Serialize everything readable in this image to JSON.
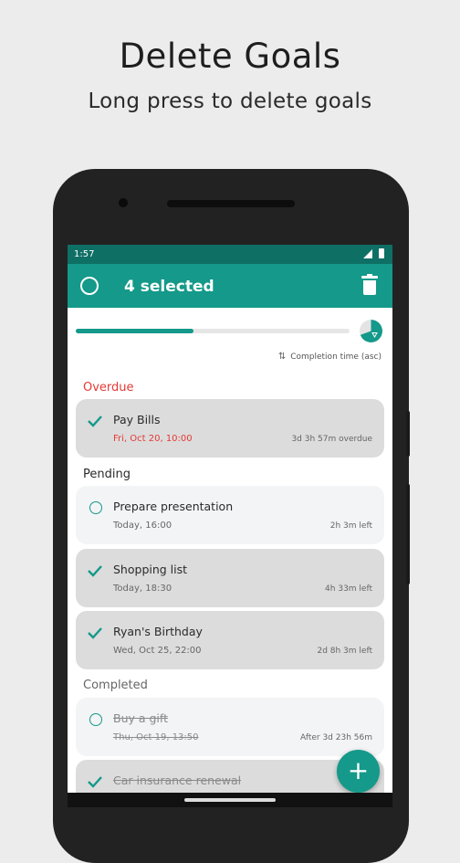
{
  "promo": {
    "title": "Delete Goals",
    "subtitle": "Long press to delete goals"
  },
  "statusbar": {
    "time": "1:57"
  },
  "appbar": {
    "selected_label": "4 selected"
  },
  "progress": {
    "value": 0.43
  },
  "sort": {
    "label": "Completion time (asc)"
  },
  "sections": {
    "overdue": "Overdue",
    "pending": "Pending",
    "completed": "Completed"
  },
  "goals": [
    {
      "title": "Pay Bills",
      "date": "Fri, Oct 20, 10:00",
      "time_left": "3d 3h 57m overdue",
      "selected": true
    },
    {
      "title": "Prepare presentation",
      "date": "Today, 16:00",
      "time_left": "2h 3m left",
      "selected": false
    },
    {
      "title": "Shopping list",
      "date": "Today, 18:30",
      "time_left": "4h 33m left",
      "selected": true
    },
    {
      "title": "Ryan's Birthday",
      "date": "Wed, Oct 25, 22:00",
      "time_left": "2d 8h 3m left",
      "selected": true
    },
    {
      "title": "Buy a gift",
      "date": "Thu, Oct 19, 13:50",
      "time_left": "After 3d 23h 56m",
      "selected": false
    },
    {
      "title": "Car insurance renewal",
      "date": "",
      "time_left": "",
      "selected": true
    }
  ],
  "colors": {
    "primary": "#14998a",
    "primary_dark": "#0e6f65",
    "overdue": "#e53935"
  },
  "icons": {
    "select_all": "circle-outline-icon",
    "delete": "trash-icon",
    "stats": "pie-chart-icon",
    "sort": "sort-icon",
    "add": "plus-icon"
  }
}
